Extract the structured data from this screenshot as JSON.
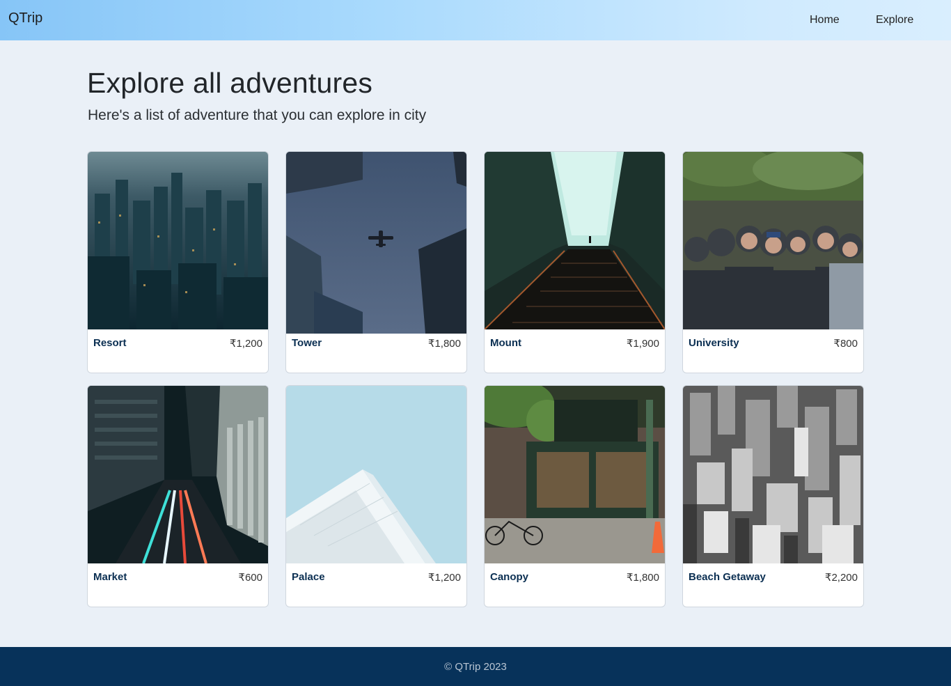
{
  "brand": "QTrip",
  "nav": {
    "home": "Home",
    "explore": "Explore"
  },
  "page": {
    "title": "Explore all adventures",
    "subtitle": "Here's a list of adventure that you can explore in city"
  },
  "adventures": [
    {
      "name": "Resort",
      "price": "₹1,200"
    },
    {
      "name": "Tower",
      "price": "₹1,800"
    },
    {
      "name": "Mount",
      "price": "₹1,900"
    },
    {
      "name": "University",
      "price": "₹800"
    },
    {
      "name": "Market",
      "price": "₹600"
    },
    {
      "name": "Palace",
      "price": "₹1,200"
    },
    {
      "name": "Canopy",
      "price": "₹1,800"
    },
    {
      "name": "Beach Getaway",
      "price": "₹2,200"
    }
  ],
  "footer": {
    "text": "© QTrip 2023"
  },
  "colors": {
    "accent_name": "#0b2f52",
    "footer_bg": "#07325a",
    "page_bg": "#eaf0f7"
  }
}
